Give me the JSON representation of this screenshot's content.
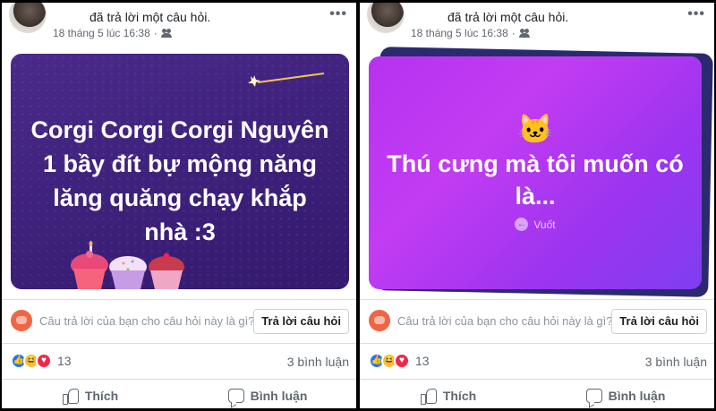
{
  "posts": [
    {
      "action_text": "đã trả lời một câu hỏi.",
      "date": "18 tháng 5 lúc 16:38",
      "card_text": "Corgi Corgi Corgi Nguyên 1 bầy đít bự mộng năng lăng quăng chạy khắp nhà :3",
      "answer_prompt": "Câu trả lời của bạn cho câu hỏi này là gì?",
      "answer_button": "Trả lời câu hỏi",
      "reaction_count": "13",
      "comment_count": "3 bình luận",
      "like_label": "Thích",
      "comment_label": "Bình luận",
      "more": "•••"
    },
    {
      "action_text": "đã trả lời một câu hỏi.",
      "date": "18 tháng 5 lúc 16:38",
      "card_emoji": "🐱",
      "card_text": "Thú cưng mà tôi muốn có là...",
      "swipe_label": "Vuốt",
      "answer_prompt": "Câu trả lời của bạn cho câu hỏi này là gì?",
      "answer_button": "Trả lời câu hỏi",
      "reaction_count": "13",
      "comment_count": "3 bình luận",
      "like_label": "Thích",
      "comment_label": "Bình luận",
      "more": "•••"
    }
  ],
  "colors": {
    "card_left_bg": "#3b1f78",
    "card_right_bg": "#b632f0",
    "like_blue": "#2078f4",
    "love_red": "#f0284a",
    "haha_yellow": "#f7c33a",
    "answer_icon": "#f06543"
  },
  "icons": [
    "avatar",
    "friends-icon",
    "more-options-icon",
    "magic-wand-icon",
    "cupcakes-illustration",
    "cat-face-icon",
    "swipe-arrow-icon",
    "question-answer-icon",
    "like-reaction-icon",
    "haha-reaction-icon",
    "love-reaction-icon",
    "thumbs-up-icon",
    "comment-icon"
  ]
}
